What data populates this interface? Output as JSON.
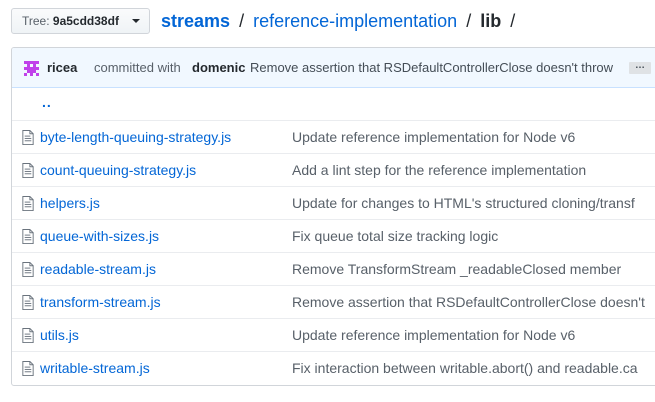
{
  "tree": {
    "label": "Tree:",
    "value": "9a5cdd38df"
  },
  "breadcrumb": {
    "repo": "streams",
    "sep1": "/",
    "folder": "reference-implementation",
    "sep2": "/",
    "current": "lib",
    "sep3": "/"
  },
  "commit": {
    "author": "ricea",
    "with_text": "committed with",
    "committer": "domenic",
    "message": "Remove assertion that RSDefaultControllerClose doesn't throw",
    "ellipsis": "…"
  },
  "parent_dir": "..",
  "files": [
    {
      "name": "byte-length-queuing-strategy.js",
      "message": "Update reference implementation for Node v6"
    },
    {
      "name": "count-queuing-strategy.js",
      "message": "Add a lint step for the reference implementation"
    },
    {
      "name": "helpers.js",
      "message": "Update for changes to HTML's structured cloning/transf"
    },
    {
      "name": "queue-with-sizes.js",
      "message": "Fix queue total size tracking logic"
    },
    {
      "name": "readable-stream.js",
      "message": "Remove TransformStream _readableClosed member"
    },
    {
      "name": "transform-stream.js",
      "message": "Remove assertion that RSDefaultControllerClose doesn't"
    },
    {
      "name": "utils.js",
      "message": "Update reference implementation for Node v6"
    },
    {
      "name": "writable-stream.js",
      "message": "Fix interaction between writable.abort() and readable.ca"
    }
  ],
  "icons": {
    "avatar": "identicon-avatar",
    "file": "file-text-icon",
    "dropdown": "caret-down-icon"
  },
  "colors": {
    "link": "#0366d6",
    "commit_bg": "#f1f8ff",
    "avatar": "#c041ea"
  }
}
